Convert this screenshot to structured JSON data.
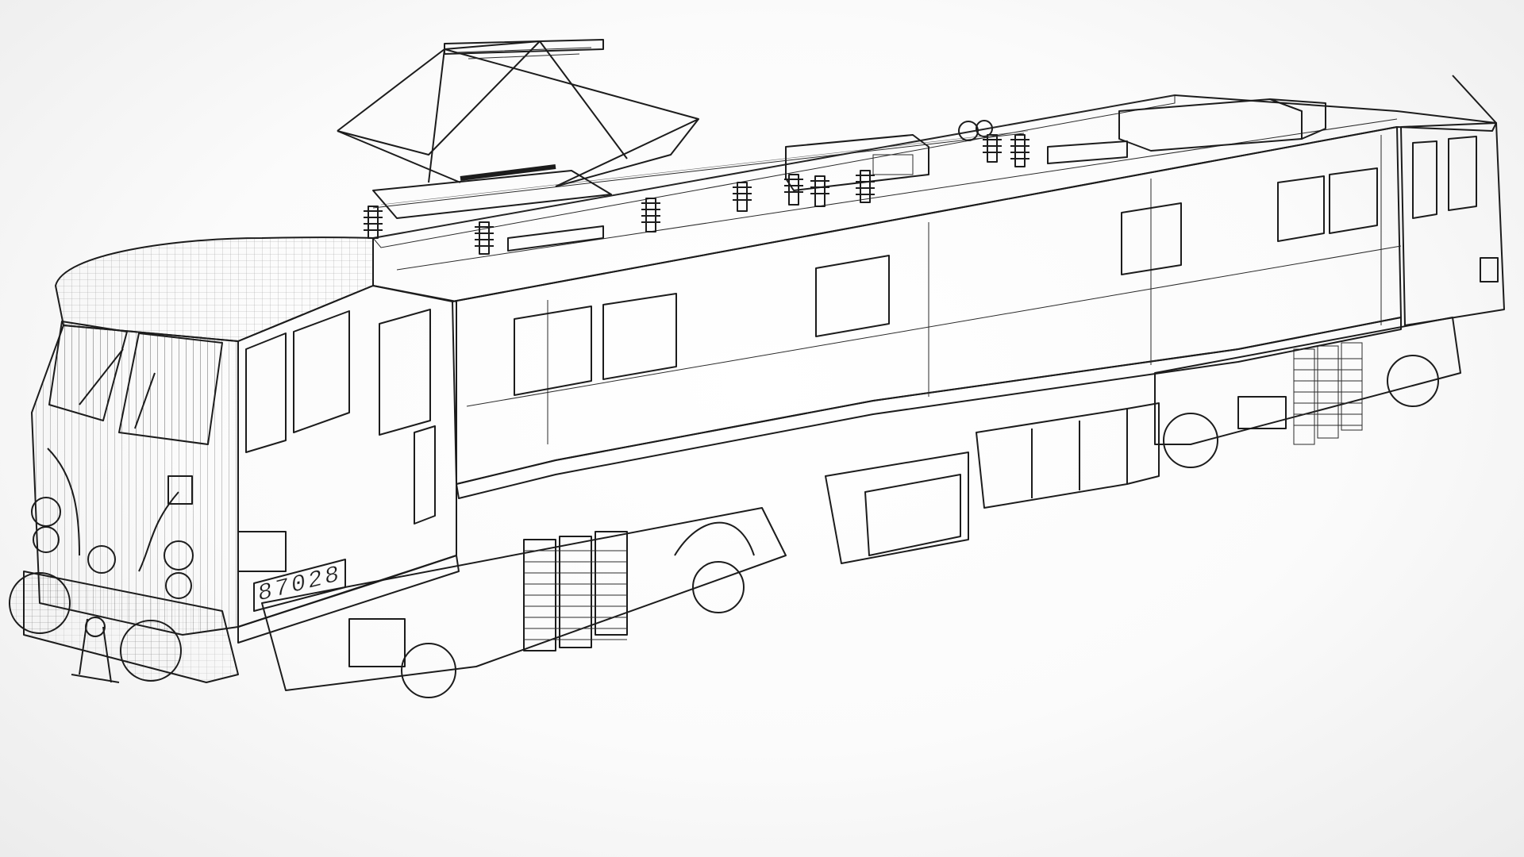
{
  "scene": {
    "subject": "wireframe-shaded-3d-render",
    "background_color": "#fafafa",
    "body_color": "#8f8f8f",
    "body_light_color": "#a9a9a9",
    "window_color": "#6f6f6f",
    "edge_color": "#1c1c1c"
  },
  "locomotive": {
    "number_plate": "87028"
  }
}
